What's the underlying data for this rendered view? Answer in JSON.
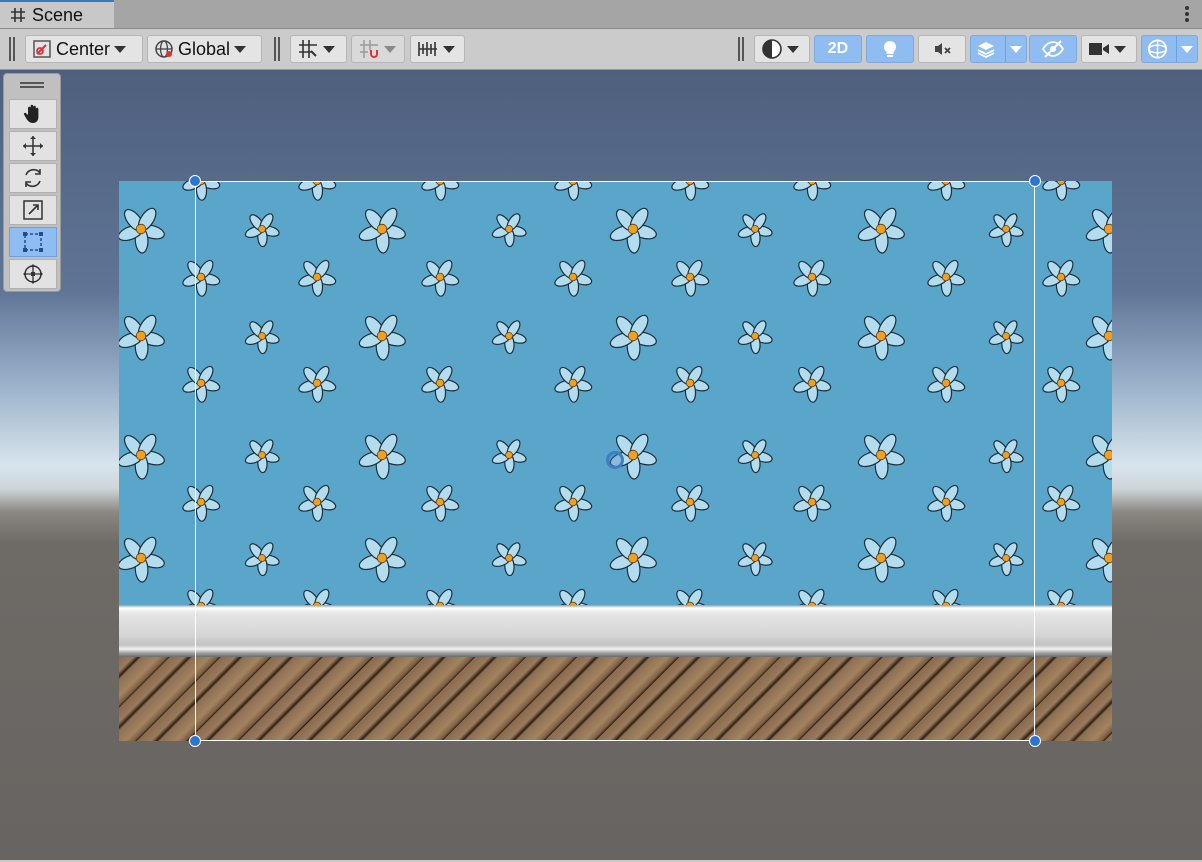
{
  "window": {
    "tab_title": "Scene"
  },
  "toolbar": {
    "pivot_mode": "Center",
    "pivot_rotation": "Global",
    "view_2d_label": "2D"
  },
  "tools": [
    "hand",
    "move",
    "rotate",
    "scale",
    "rect",
    "transform"
  ],
  "colors": {
    "accent": "#8fbdf2",
    "selection_handle": "#2a76d2",
    "wall": "#5aa6cb"
  }
}
